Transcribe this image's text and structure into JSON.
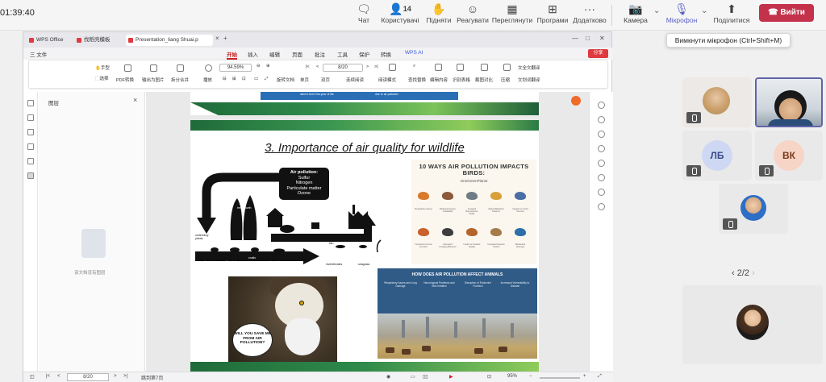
{
  "teams": {
    "timer": "01:39:40",
    "toolbar": {
      "chat": "Чат",
      "people": "Користувачі",
      "people_count": "14",
      "raise": "Підняти",
      "react": "Реагувати",
      "view": "Переглянути",
      "apps": "Програми",
      "more": "Додатково",
      "camera": "Камера",
      "mic": "Мікрофон",
      "share": "Поділитися",
      "leave": "Вийти"
    },
    "tooltip": "Вимкнути мікрофон (Ctrl+Shift+M)",
    "participants": [
      {
        "initials": ""
      },
      {
        "initials": ""
      },
      {
        "initials": "ЛБ",
        "color": "#cfd8f3",
        "text_color": "#3b4a8c"
      },
      {
        "initials": "ВК",
        "color": "#f6d5c6",
        "text_color": "#7a3b1e"
      },
      {
        "initials": ""
      }
    ],
    "pager": "2/2"
  },
  "wps": {
    "tabs": [
      "WPS Office",
      "找稻壳模板",
      "Presentation_liang Shuai.p"
    ],
    "menu": [
      "三 文件",
      "开始",
      "插入",
      "编辑",
      "页面",
      "批注",
      "工具",
      "保护",
      "转换",
      "WPS AI"
    ],
    "share_btn": "分享",
    "ribbon": {
      "hand": "手型",
      "select": "选择",
      "pdf_convert": "PDF转换",
      "export_img": "输出为图片",
      "split_merge": "拆分合并",
      "play": "播放",
      "zoom": "94.59%",
      "rotate": "旋转文档",
      "single": "单页",
      "double": "双页",
      "continuous": "连续阅读",
      "read_mode": "阅读模式",
      "page_field": "8/20",
      "find": "查找替换",
      "edit": "编辑内容",
      "ocr": "识别表格",
      "screenshot": "截图对比",
      "compress": "压缩",
      "translate": "全文翻译",
      "translate2": "划词翻译"
    },
    "layers_panel": {
      "title": "图层",
      "empty": "该文档没有图层"
    },
    "status": {
      "page": "8/20",
      "goto": "跳到第7页",
      "zoom": "95%"
    },
    "slide": {
      "prev_text_1": "died in their first year of life",
      "prev_text_2": "due to air pollution",
      "title": "3. Importance of air quality for wildlife",
      "bubble_title": "Air pollution:",
      "bubble_items": [
        "Sulfur",
        "Nitrogen",
        "Particulate matter",
        "Ozone"
      ],
      "cycle_labels": {
        "tree": "tree growth",
        "understory": "understory plants",
        "soil": "soil bacteria",
        "fungi": "fungi",
        "snails": "snails",
        "salamanders": "salamanders",
        "fish": "fish",
        "invertebrates": "invertebrates",
        "seagrass": "seagrass"
      },
      "poster1_title": "10 WAYS AIR POLLUTION IMPACTS BIRDS:",
      "poster1_sub": "OneGreenPlanet",
      "poster1_items": [
        "Respiratory Issues",
        "Reduced Oxygen Availability",
        "Impaired Reproductive Ability",
        "Altered Migration Patterns",
        "Impacts on Food Sources",
        "Increased Immune Function",
        "Disrupted Foraging Behavior",
        "Impact on Feather Quality",
        "Increased Species Toxicity",
        "Behavioral Changes"
      ],
      "osprey_speech": "WILL YOU SAVE ME FROM AIR POLLUTION?",
      "poster2_title": "HOW DOES AIR POLLUTION AFFECT ANIMALS",
      "poster2_cols": [
        "Respiratory Issues and Lung Damage",
        "Neurological Problems and Skin Irritation",
        "Disruption of Endocrine Function",
        "Increased Vulnerability to Disease"
      ]
    }
  }
}
